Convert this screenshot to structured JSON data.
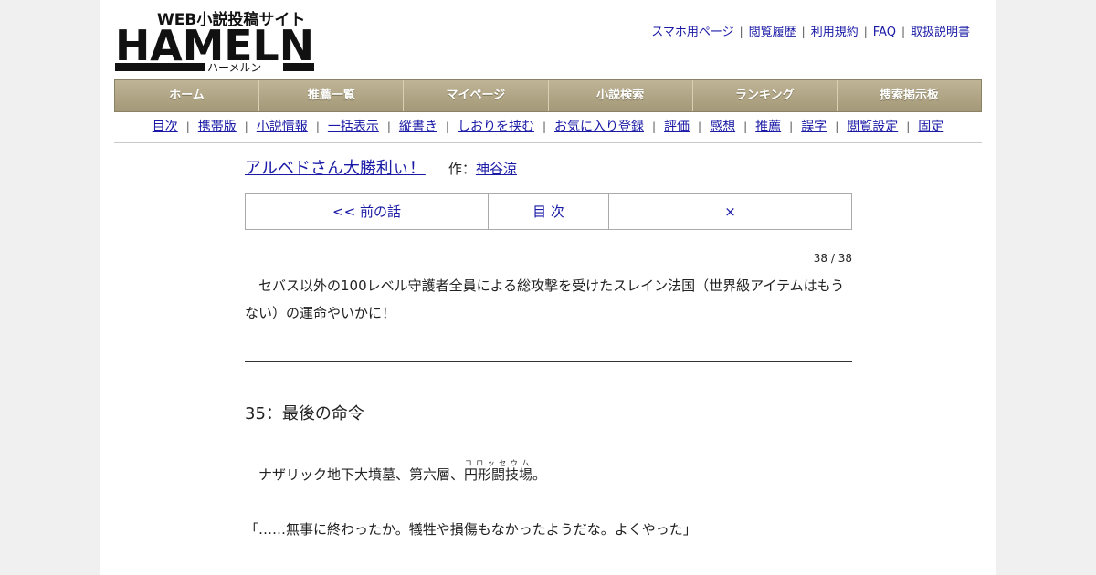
{
  "site": {
    "logo_tagline": "WEB小説投稿サイト",
    "logo_word": "HAMELN",
    "logo_kana": "ハーメルン"
  },
  "toplinks": [
    "スマホ用ページ",
    "閲覧履歴",
    "利用規約",
    "FAQ",
    "取扱説明書"
  ],
  "mainnav": [
    "ホーム",
    "推薦一覧",
    "マイページ",
    "小説検索",
    "ランキング",
    "捜索掲示板"
  ],
  "subnav": [
    "目次",
    "携帯版",
    "小説情報",
    "一括表示",
    "縦書き",
    "しおりを挟む",
    "お気に入り登録",
    "評価",
    "感想",
    "推薦",
    "誤字",
    "閲覧設定",
    "固定"
  ],
  "novel": {
    "title": "アルベドさん大勝利ぃ！",
    "author_label": "作：",
    "author": "神谷涼"
  },
  "pager": {
    "prev": "<< 前の話",
    "toc": "目 次",
    "close": "×"
  },
  "counter": "38 / 38",
  "preface": "セバス以外の100レベル守護者全員による総攻撃を受けたスレイン法国（世界級アイテムはもうない）の運命やいかに！",
  "chapter_title": "35：最後の命令",
  "body": {
    "line1_before": "ナザリック地下大墳墓、第六層、",
    "line1_ruby_base": "円形闘技場",
    "line1_ruby_text": "コロッセウム",
    "line1_after": "。",
    "line2": "「……無事に終わったか。犠牲や損傷もなかったようだな。よくやった」"
  }
}
